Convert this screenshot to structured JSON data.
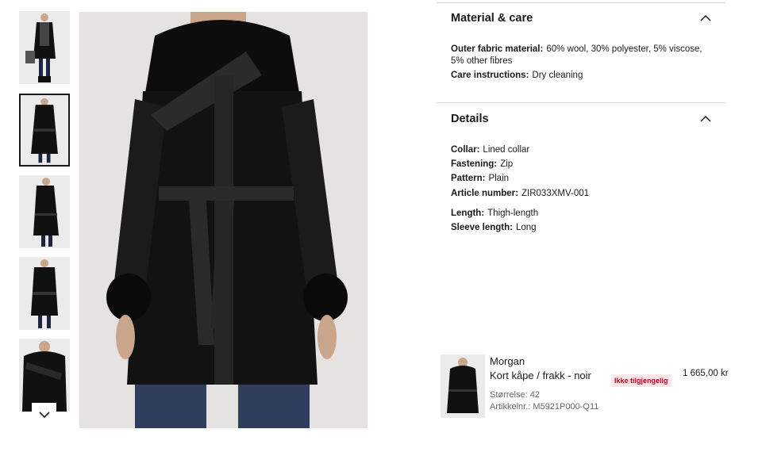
{
  "gallery": {
    "thumbnails": [
      {
        "alt": "Model with bag, full length"
      },
      {
        "alt": "Front view, belted"
      },
      {
        "alt": "Side view"
      },
      {
        "alt": "Front view, buttoned"
      },
      {
        "alt": "Collar detail"
      }
    ],
    "selected_index": 1
  },
  "material_care": {
    "title": "Material & care",
    "outer_label": "Outer fabric material:",
    "outer_value": "60% wool, 30% polyester, 5% viscose, 5% other fibres",
    "care_label": "Care instructions:",
    "care_value": "Dry cleaning"
  },
  "details": {
    "title": "Details",
    "collar_label": "Collar:",
    "collar_value": "Lined collar",
    "fastening_label": "Fastening:",
    "fastening_value": "Zip",
    "pattern_label": "Pattern:",
    "pattern_value": "Plain",
    "article_label": "Article number:",
    "article_value": "ZIR033XMV-001",
    "length_label": "Length:",
    "length_value": "Thigh-length",
    "sleeve_label": "Sleeve length:",
    "sleeve_value": "Long"
  },
  "cart_item": {
    "brand": "Morgan",
    "name": "Kort kåpe / frakk - noir",
    "size": "Størrelse: 42",
    "article": "Artikkelnr.: M5921P000-Q11",
    "status": "Ikke tilgjengelig",
    "price": "1 665,00 kr"
  },
  "colors": {
    "status_red": "#d0021b",
    "text": "#1a1a1a",
    "divider": "#d9d9d9"
  }
}
